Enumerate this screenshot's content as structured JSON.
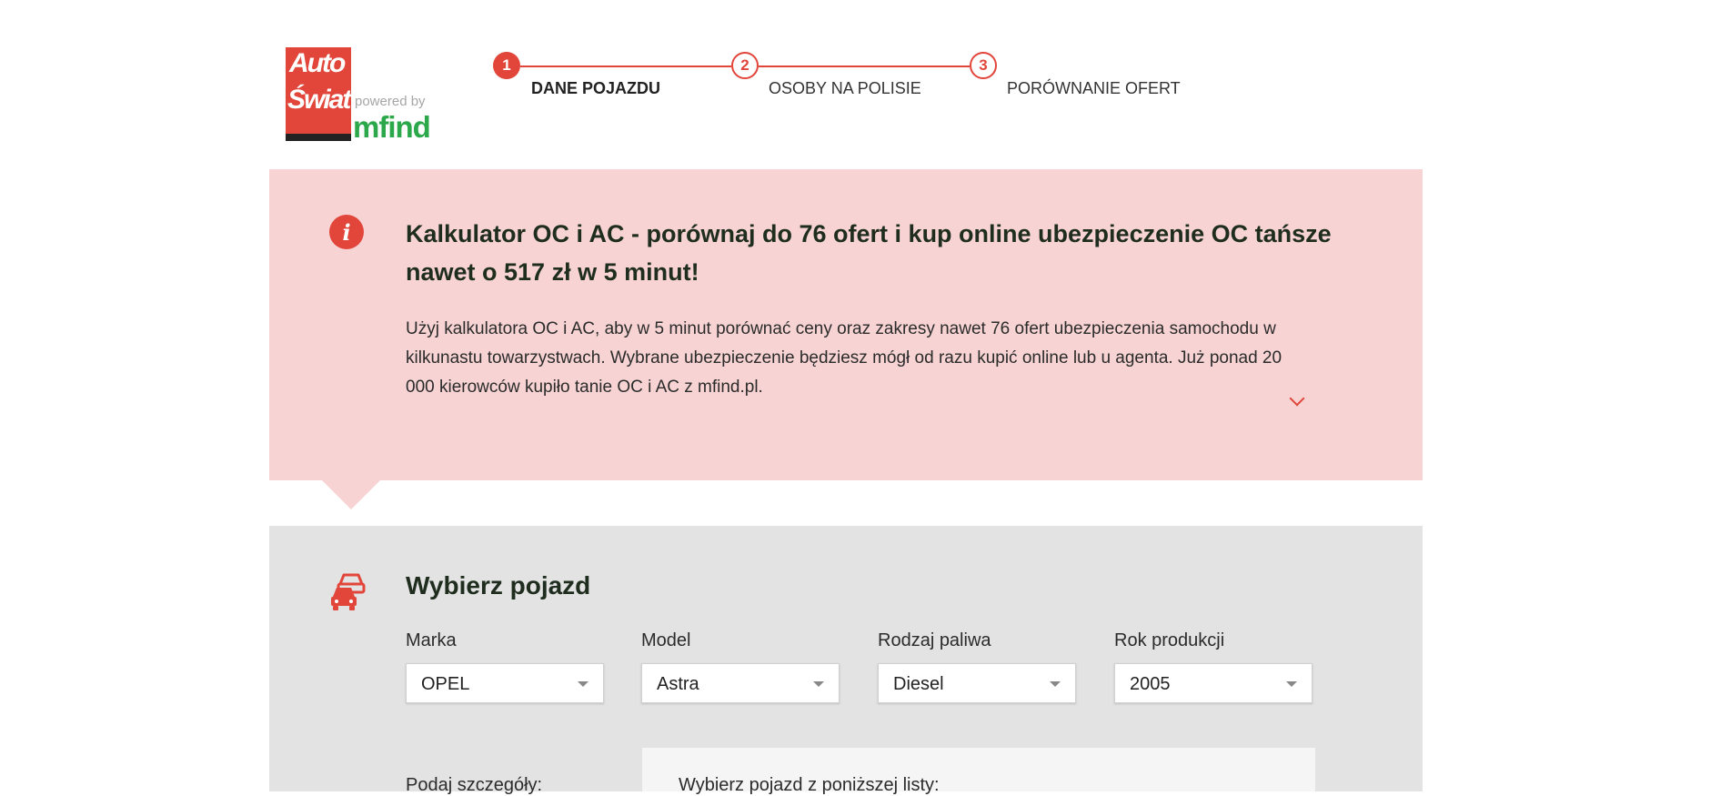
{
  "logo": {
    "line1": "Auto",
    "line2": "Świat",
    "powered_by": "powered by",
    "partner": "mfind"
  },
  "stepper": {
    "steps": [
      {
        "number": "1",
        "label": "DANE POJAZDU",
        "active": true
      },
      {
        "number": "2",
        "label": "OSOBY NA POLISIE",
        "active": false
      },
      {
        "number": "3",
        "label": "PORÓWNANIE OFERT",
        "active": false
      }
    ]
  },
  "banner": {
    "icon": "info-icon",
    "title": "Kalkulator OC i AC - porównaj do 76 ofert i kup online ubezpieczenie OC tańsze nawet o 517 zł w 5 minut!",
    "text": "Użyj kalkulatora OC i AC, aby w 5 minut porównać ceny oraz zakresy nawet 76 ofert ubezpieczenia samochodu w kilkunastu towarzystwach. Wybrane ubezpieczenie będziesz mógł od razu kupić online lub u agenta. Już ponad 20 000 kierowców kupiło tanie OC i AC z mfind.pl.",
    "expand_icon": "chevron-down-icon"
  },
  "vehicle": {
    "icon": "cars-icon",
    "title": "Wybierz pojazd",
    "fields": [
      {
        "label": "Marka",
        "value": "OPEL"
      },
      {
        "label": "Model",
        "value": "Astra"
      },
      {
        "label": "Rodzaj paliwa",
        "value": "Diesel"
      },
      {
        "label": "Rok produkcji",
        "value": "2005"
      }
    ],
    "details_label": "Podaj szczegóły:",
    "list_label": "Wybierz pojazd z poniższej listy:"
  },
  "colors": {
    "accent": "#e2453a",
    "banner_bg": "#f7d4d3",
    "section_bg": "#e3e3e3",
    "partner_green": "#2aa84a"
  }
}
